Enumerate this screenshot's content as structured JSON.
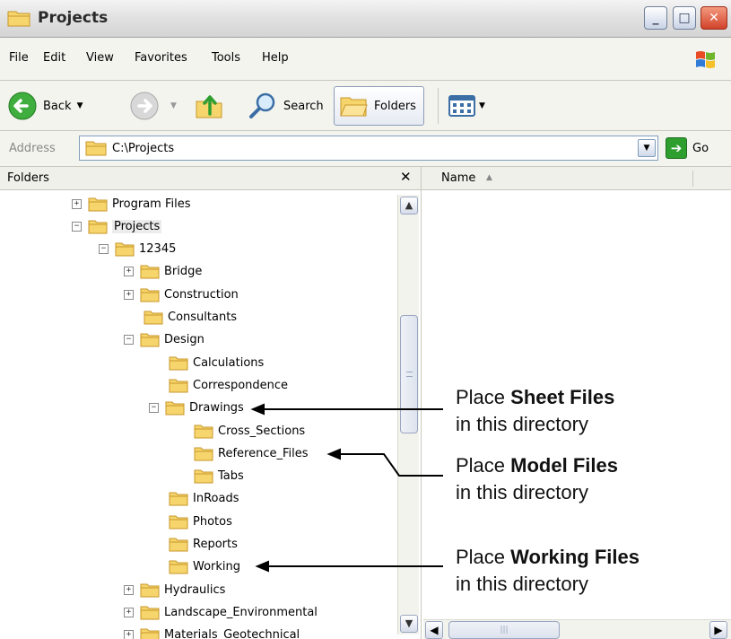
{
  "window": {
    "title": "Projects",
    "minimize": "_",
    "maximize": "□",
    "close": "✕"
  },
  "menu": [
    "File",
    "Edit",
    "View",
    "Favorites",
    "Tools",
    "Help"
  ],
  "toolbar": {
    "back_label": "Back",
    "search_label": "Search",
    "folders_label": "Folders"
  },
  "address": {
    "label": "Address",
    "value": "C:\\Projects",
    "go_label": "Go"
  },
  "folders_pane": {
    "header": "Folders",
    "close": "✕"
  },
  "list_pane": {
    "column_name": "Name"
  },
  "tree": [
    {
      "label": "Program Files",
      "expander": "+"
    },
    {
      "label": "Projects",
      "expander": "−"
    },
    {
      "label": "12345",
      "expander": "−"
    },
    {
      "label": "Bridge",
      "expander": "+"
    },
    {
      "label": "Construction",
      "expander": "+"
    },
    {
      "label": "Consultants",
      "expander": ""
    },
    {
      "label": "Design",
      "expander": "−"
    },
    {
      "label": "Calculations",
      "expander": ""
    },
    {
      "label": "Correspondence",
      "expander": ""
    },
    {
      "label": "Drawings",
      "expander": "−"
    },
    {
      "label": "Cross_Sections",
      "expander": ""
    },
    {
      "label": "Reference_Files",
      "expander": ""
    },
    {
      "label": "Tabs",
      "expander": ""
    },
    {
      "label": "InRoads",
      "expander": ""
    },
    {
      "label": "Photos",
      "expander": ""
    },
    {
      "label": "Reports",
      "expander": ""
    },
    {
      "label": "Working",
      "expander": ""
    },
    {
      "label": "Hydraulics",
      "expander": "+"
    },
    {
      "label": "Landscape_Environmental",
      "expander": "+"
    },
    {
      "label": "Materials_Geotechnical",
      "expander": "+"
    }
  ],
  "annotations": {
    "sheet": {
      "prefix": "Place ",
      "bold": "Sheet Files",
      "line2": "in this directory"
    },
    "model": {
      "prefix": "Place ",
      "bold": "Model Files",
      "line2": "in this directory"
    },
    "working": {
      "prefix": "Place ",
      "bold": "Working Files",
      "line2": "in this directory"
    }
  },
  "colors": {
    "folder_fill": "#f6d66c",
    "folder_stroke": "#c8962a",
    "accent_blue": "#3a6ea5",
    "go_green": "#2e9e2e",
    "close_red": "#d2422a"
  }
}
